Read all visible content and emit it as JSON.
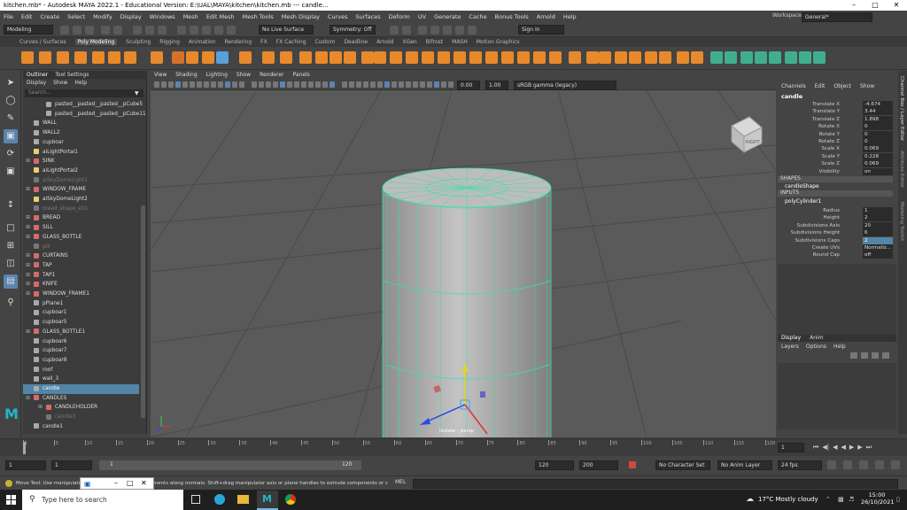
{
  "window": {
    "title": "kitchen.mb* - Autodesk MAYA 2022.1 - Educational Version: E:\\UAL\\MAYA\\kitchen\\kitchen.mb   ---   candle..."
  },
  "menubar": [
    "File",
    "Edit",
    "Create",
    "Select",
    "Modify",
    "Display",
    "Windows",
    "Mesh",
    "Edit Mesh",
    "Mesh Tools",
    "Mesh Display",
    "Curves",
    "Surfaces",
    "Deform",
    "UV",
    "Generate",
    "Cache",
    "Bonus Tools",
    "Arnold",
    "Help"
  ],
  "workspace": {
    "label": "Workspace:",
    "value": "General*"
  },
  "statusline": {
    "menuset": "Modeling",
    "live_surface": "No Live Surface",
    "symmetry": "Symmetry: Off",
    "sign_in": "Sign In"
  },
  "shelf_tabs": [
    "Curves / Surfaces",
    "Poly Modeling",
    "Sculpting",
    "Rigging",
    "Animation",
    "Rendering",
    "FX",
    "FX Caching",
    "Custom",
    "Deadline",
    "Arnold",
    "XGen",
    "Bifrost",
    "MASH",
    "Motion Graphics"
  ],
  "shelf_active": "Poly Modeling",
  "outliner": {
    "tabs": [
      "Outliner",
      "Tool Settings"
    ],
    "menu": [
      "Display",
      "Show",
      "Help"
    ],
    "search_placeholder": "Search...",
    "items": [
      {
        "label": "pasted__pasted__pasted__pCube5",
        "type": "mesh",
        "indent": 1
      },
      {
        "label": "pasted__pasted__pasted__pCube11",
        "type": "mesh",
        "indent": 1
      },
      {
        "label": "WALL",
        "type": "mesh",
        "indent": 0
      },
      {
        "label": "WALL2",
        "type": "mesh",
        "indent": 0
      },
      {
        "label": "cupboar",
        "type": "mesh",
        "indent": 0
      },
      {
        "label": "aiLightPortal1",
        "type": "light",
        "indent": 0
      },
      {
        "label": "SINK",
        "type": "group",
        "indent": 0
      },
      {
        "label": "aiLightPortal2",
        "type": "light",
        "indent": 0
      },
      {
        "label": "aiSkyDomeLight1",
        "type": "dim",
        "indent": 0
      },
      {
        "label": "WINDOW_FRAME",
        "type": "group",
        "indent": 0
      },
      {
        "label": "aiSkyDomeLight2",
        "type": "light",
        "indent": 0
      },
      {
        "label": "bread_shape_e01",
        "type": "dim",
        "indent": 0
      },
      {
        "label": "BREAD",
        "type": "group",
        "indent": 0
      },
      {
        "label": "SILL",
        "type": "group",
        "indent": 0
      },
      {
        "label": "GLASS_BOTTLE",
        "type": "group",
        "indent": 0
      },
      {
        "label": "pill",
        "type": "dim",
        "indent": 0
      },
      {
        "label": "CURTAINS",
        "type": "group",
        "indent": 0
      },
      {
        "label": "TAP",
        "type": "group",
        "indent": 0
      },
      {
        "label": "TAP1",
        "type": "group",
        "indent": 0
      },
      {
        "label": "KNIFE",
        "type": "group",
        "indent": 0
      },
      {
        "label": "WINDOW_FRAME1",
        "type": "group",
        "indent": 0
      },
      {
        "label": "pPlane1",
        "type": "mesh",
        "indent": 0
      },
      {
        "label": "cupboar1",
        "type": "mesh",
        "indent": 0
      },
      {
        "label": "cupboar5",
        "type": "mesh",
        "indent": 0
      },
      {
        "label": "GLASS_BOTTLE1",
        "type": "group",
        "indent": 0
      },
      {
        "label": "cupboar6",
        "type": "mesh",
        "indent": 0
      },
      {
        "label": "cupboar7",
        "type": "mesh",
        "indent": 0
      },
      {
        "label": "cupboar8",
        "type": "mesh",
        "indent": 0
      },
      {
        "label": "roof",
        "type": "mesh",
        "indent": 0
      },
      {
        "label": "wall_3",
        "type": "mesh",
        "indent": 0
      },
      {
        "label": "candle",
        "type": "mesh",
        "indent": 0,
        "selected": true
      },
      {
        "label": "CANDLES",
        "type": "group",
        "indent": 0
      },
      {
        "label": "CANDLEHOLDER",
        "type": "group",
        "indent": 1
      },
      {
        "label": "candle3",
        "type": "dim",
        "indent": 1
      },
      {
        "label": "candle1",
        "type": "mesh",
        "indent": 0
      }
    ]
  },
  "viewport": {
    "menu": [
      "View",
      "Shading",
      "Lighting",
      "Show",
      "Renderer",
      "Panels"
    ],
    "exposure": "0.00",
    "gamma": "1.00",
    "colorspace": "sRGB gamma (legacy)",
    "hud_label": "Isolate : persp",
    "viewcube_label": "RIGHT"
  },
  "channel_box": {
    "menu": [
      "Channels",
      "Edit",
      "Object",
      "Show"
    ],
    "object": "candle",
    "attributes": [
      {
        "label": "Translate X",
        "value": "-4.674"
      },
      {
        "label": "Translate Y",
        "value": "3.44"
      },
      {
        "label": "Translate Z",
        "value": "1.898"
      },
      {
        "label": "Rotate X",
        "value": "0"
      },
      {
        "label": "Rotate Y",
        "value": "0"
      },
      {
        "label": "Rotate Z",
        "value": "0"
      },
      {
        "label": "Scale X",
        "value": "0.069"
      },
      {
        "label": "Scale Y",
        "value": "0.228"
      },
      {
        "label": "Scale Z",
        "value": "0.069"
      },
      {
        "label": "Visibility",
        "value": "on"
      }
    ],
    "shapes_header": "SHAPES",
    "shape": "candleShape",
    "inputs_header": "INPUTS",
    "input": "polyCylinder1",
    "input_attributes": [
      {
        "label": "Radius",
        "value": "1"
      },
      {
        "label": "Height",
        "value": "2"
      },
      {
        "label": "Subdivisions Axis",
        "value": "20"
      },
      {
        "label": "Subdivisions Height",
        "value": "6"
      },
      {
        "label": "Subdivisions Caps",
        "value": "2",
        "active": true
      },
      {
        "label": "Create UVs",
        "value": "Normaliz..."
      },
      {
        "label": "Round Cap",
        "value": "off"
      }
    ],
    "side_tabs": [
      "Channel Box / Layer Editor",
      "Attribute Editor",
      "Modeling Toolkit"
    ]
  },
  "layer_editor": {
    "tabs": [
      "Display",
      "Anim"
    ],
    "menu": [
      "Layers",
      "Options",
      "Help"
    ]
  },
  "timeline": {
    "ticks": [
      "1",
      "5",
      "10",
      "15",
      "20",
      "25",
      "30",
      "35",
      "40",
      "45",
      "50",
      "55",
      "60",
      "65",
      "70",
      "75",
      "80",
      "85",
      "90",
      "95",
      "100",
      "105",
      "110",
      "115",
      "120"
    ],
    "current_frame": "1"
  },
  "range": {
    "start": "1",
    "start_inner": "1",
    "slider_start": "1",
    "slider_end": "120",
    "end_inner": "120",
    "end": "200",
    "character_set": "No Character Set",
    "anim_layer": "No Anim Layer",
    "fps": "24 fps"
  },
  "helpline": {
    "text": "Move Tool: Use manipulator ... Ctrl+drag to move components along normals. Shift+drag manipulator axis or plane handles to extrude components or c",
    "mel": "MEL"
  },
  "taskbar": {
    "search_placeholder": "Type here to search",
    "weather": "17°C  Mostly cloudy",
    "time": "15:00",
    "date": "26/10/2021"
  }
}
